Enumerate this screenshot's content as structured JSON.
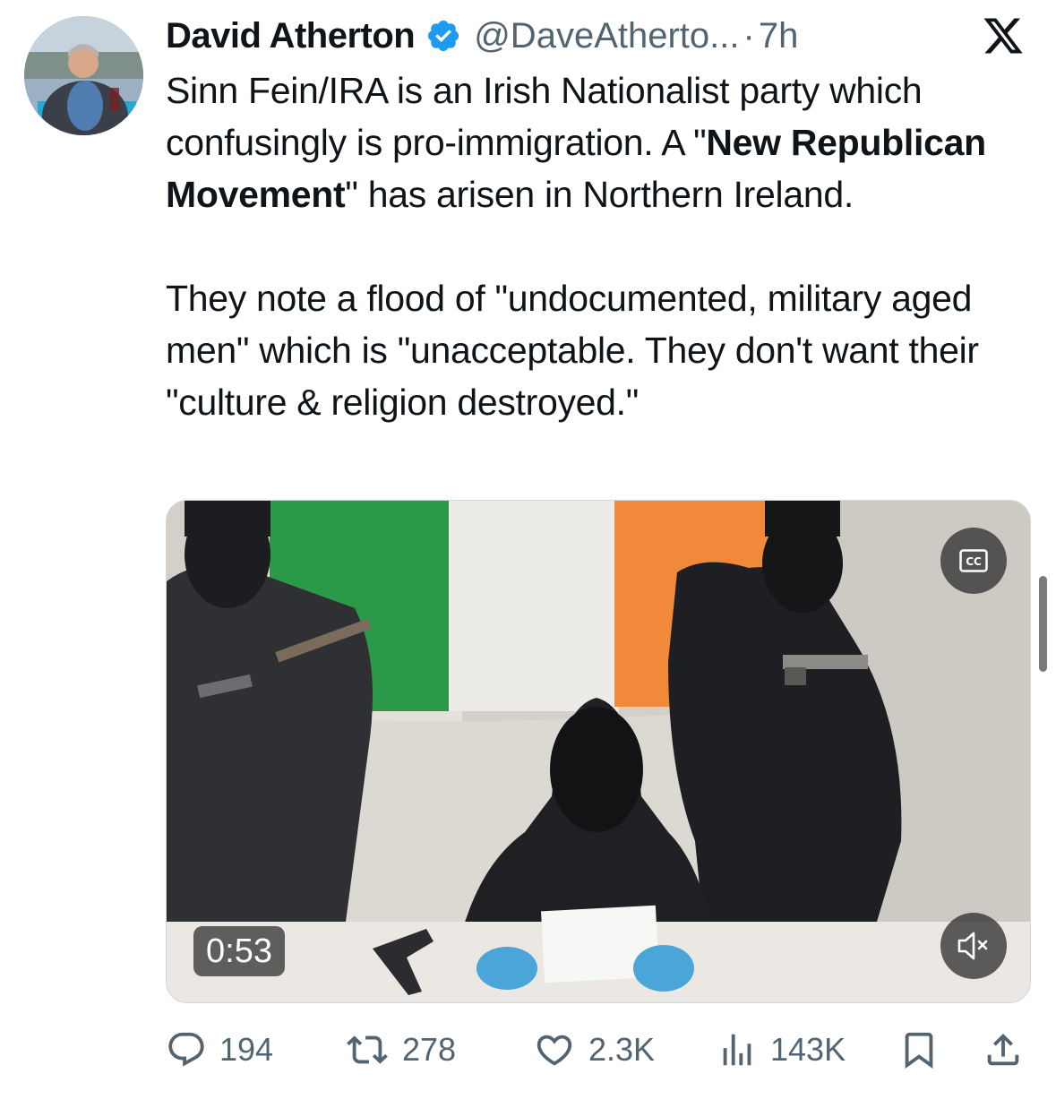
{
  "tweet": {
    "author_name": "David Atherton",
    "handle": "@DaveAtherto...",
    "separator": "·",
    "time": "7h",
    "text": {
      "p1_a": "Sinn Fein/IRA is an Irish Nationalist party which confusingly is pro-immigration. A \"",
      "p1_bold": "New Republican Movement",
      "p1_b": "\" has arisen in Northern Ireland.",
      "p2": "They note a flood of \"undocumented, military aged men\" which is \"unacceptable. They don't want their \"culture & religion destroyed.\""
    },
    "media": {
      "type": "video",
      "duration": "0:53",
      "cc_label": "CC"
    },
    "stats": {
      "replies": "194",
      "reposts": "278",
      "likes": "2.3K",
      "views": "143K"
    }
  },
  "icons": {
    "verified": "verified-badge-icon",
    "logo": "x-logo-icon",
    "reply": "reply-icon",
    "repost": "repost-icon",
    "like": "heart-icon",
    "views": "views-icon",
    "bookmark": "bookmark-icon",
    "share": "share-icon"
  },
  "colors": {
    "verified_blue": "#1d9bf0",
    "text_primary": "#0f1419",
    "text_secondary": "#536471",
    "flag_green": "#169b62",
    "flag_orange": "#ff883e"
  }
}
